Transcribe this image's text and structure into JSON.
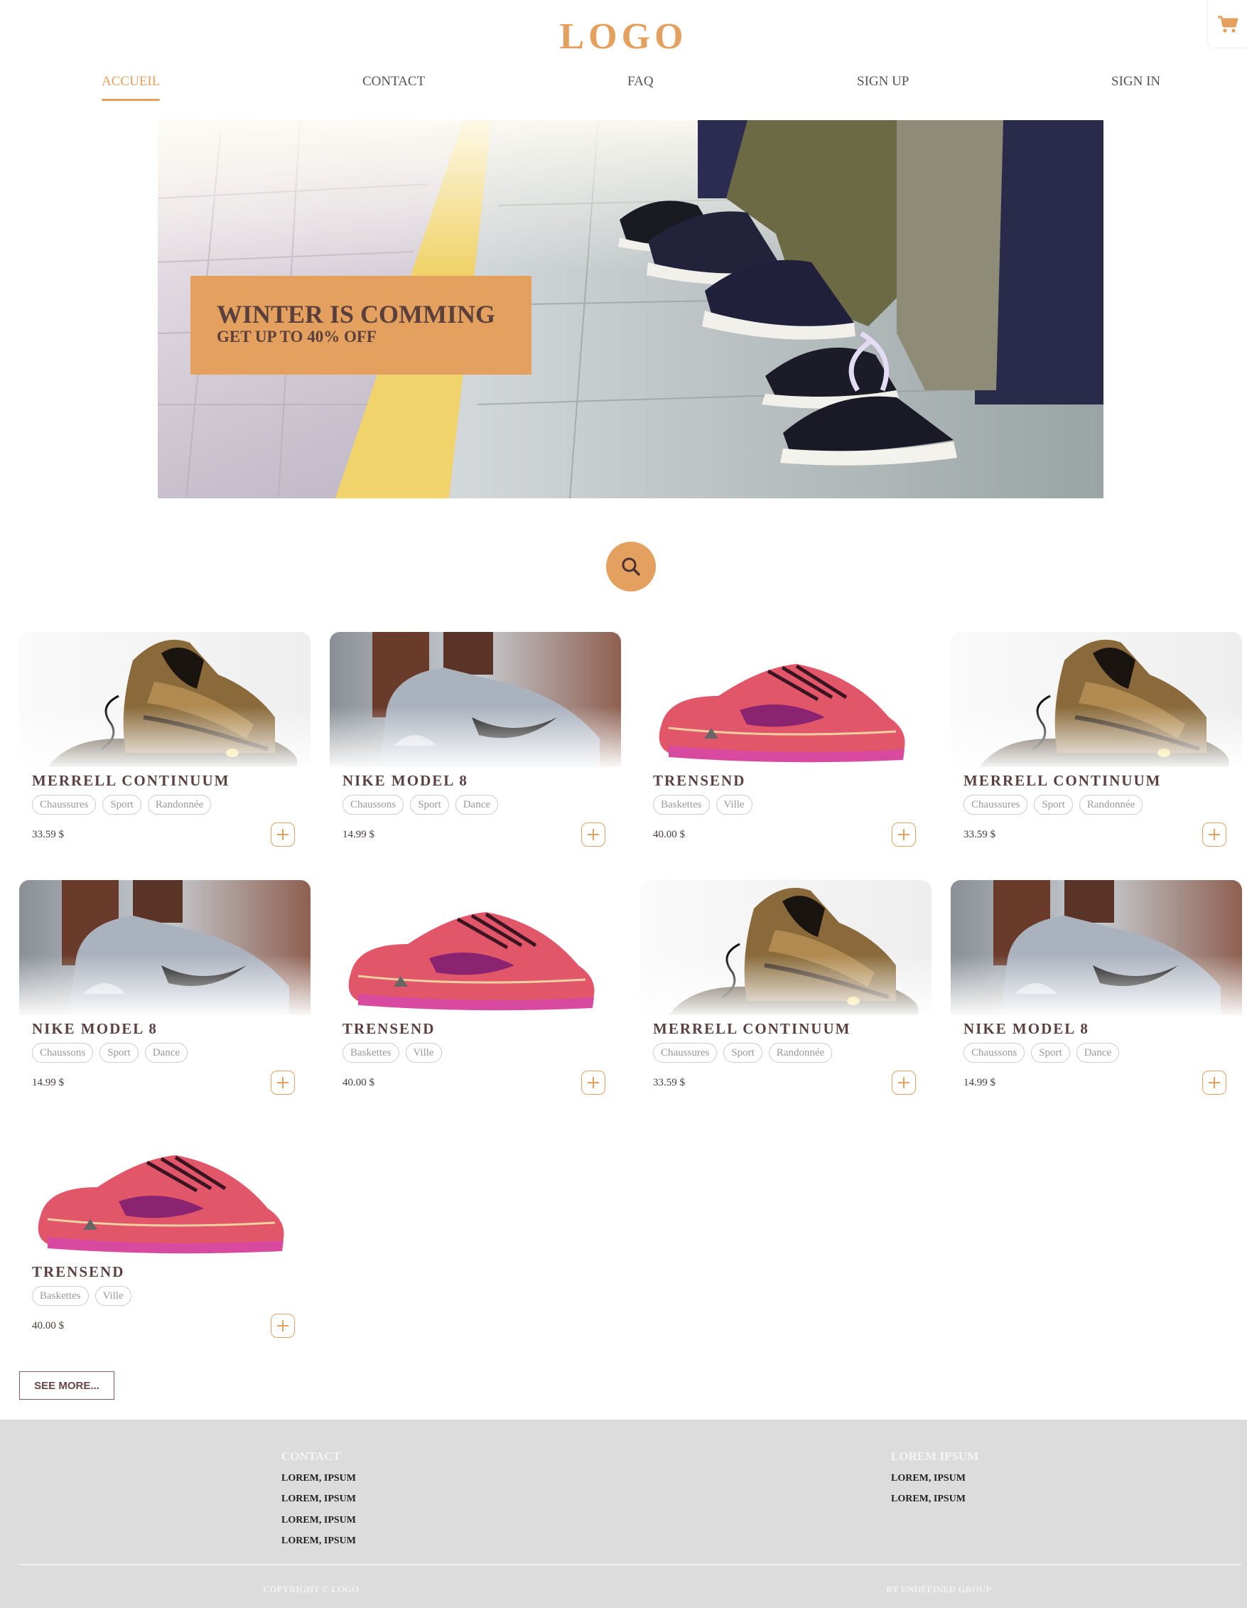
{
  "header": {
    "logo": "LOGO",
    "cart_icon": "shopping-cart-icon",
    "nav": [
      {
        "label": "ACCUEIL",
        "active": true
      },
      {
        "label": "CONTACT",
        "active": false
      },
      {
        "label": "FAQ",
        "active": false
      },
      {
        "label": "SIGN UP",
        "active": false
      },
      {
        "label": "SIGN IN",
        "active": false
      }
    ]
  },
  "hero": {
    "title": "WINTER IS COMMING",
    "subtitle": "GET UP TO 40% OFF"
  },
  "search": {
    "icon": "search-icon"
  },
  "products": [
    {
      "name": "MERRELL CONTINUUM",
      "tags": [
        "Chaussures",
        "Sport",
        "Randonnée"
      ],
      "price": "33.59 $",
      "image": "hiking-boot-photo"
    },
    {
      "name": "NIKE MODEL 8",
      "tags": [
        "Chaussons",
        "Sport",
        "Dance"
      ],
      "price": "14.99 $",
      "image": "grey-sneaker-photo"
    },
    {
      "name": "TRENSEND",
      "tags": [
        "Baskettes",
        "Ville"
      ],
      "price": "40.00 $",
      "image": "pink-runner-photo"
    },
    {
      "name": "MERRELL CONTINUUM",
      "tags": [
        "Chaussures",
        "Sport",
        "Randonnée"
      ],
      "price": "33.59 $",
      "image": "hiking-boot-photo"
    },
    {
      "name": "NIKE MODEL 8",
      "tags": [
        "Chaussons",
        "Sport",
        "Dance"
      ],
      "price": "14.99 $",
      "image": "grey-sneaker-photo"
    },
    {
      "name": "TRENSEND",
      "tags": [
        "Baskettes",
        "Ville"
      ],
      "price": "40.00 $",
      "image": "pink-runner-photo"
    },
    {
      "name": "MERRELL CONTINUUM",
      "tags": [
        "Chaussures",
        "Sport",
        "Randonnée"
      ],
      "price": "33.59 $",
      "image": "hiking-boot-photo"
    },
    {
      "name": "NIKE MODEL 8",
      "tags": [
        "Chaussons",
        "Sport",
        "Dance"
      ],
      "price": "14.99 $",
      "image": "grey-sneaker-photo"
    },
    {
      "name": "TRENSEND",
      "tags": [
        "Baskettes",
        "Ville"
      ],
      "price": "40.00 $",
      "image": "pink-runner-photo"
    }
  ],
  "see_more": "SEE MORE...",
  "footer": {
    "col1": {
      "heading": "CONTACT",
      "links": [
        "LOREM, IPSUM",
        "LOREM, IPSUM",
        "LOREM, IPSUM",
        "LOREM, IPSUM"
      ]
    },
    "col2": {
      "heading": "LOREM IPSUM",
      "links": [
        "LOREM, IPSUM",
        "LOREM, IPSUM"
      ]
    },
    "copyright": "COPYRIGHT © LOGO",
    "credit": "BY UNDEFINED GROUP"
  },
  "colors": {
    "accent": "#e3a05f",
    "title_text": "#5a4040",
    "footer_bg": "#dcdcdc"
  }
}
